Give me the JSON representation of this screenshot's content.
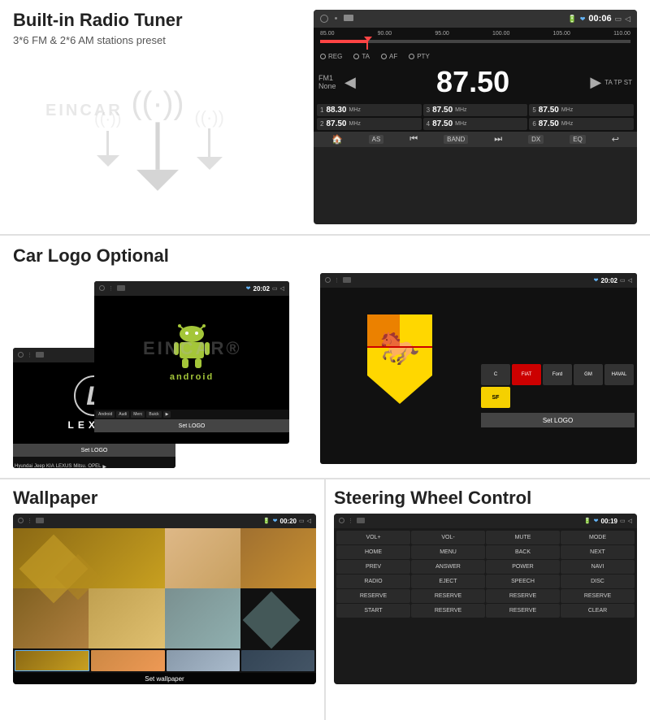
{
  "radio": {
    "title": "Built-in Radio Tuner",
    "subtitle": "3*6 FM & 2*6 AM stations preset",
    "screen": {
      "time": "00:06",
      "freq_label_start": "85.00",
      "freq_label_2": "90.00",
      "freq_label_3": "95.00",
      "freq_label_4": "100.00",
      "freq_label_5": "105.00",
      "freq_label_end": "110.00",
      "options": [
        "REG",
        "TA",
        "AF",
        "PTY"
      ],
      "station": "FM1",
      "station_name": "None",
      "frequency": "87.50",
      "suffix": "TA TP ST",
      "presets": [
        {
          "num": "1",
          "freq": "88.30",
          "unit": "MHz"
        },
        {
          "num": "3",
          "freq": "87.50",
          "unit": "MHz"
        },
        {
          "num": "5",
          "freq": "87.50",
          "unit": "MHz"
        },
        {
          "num": "2",
          "freq": "87.50",
          "unit": "MHz"
        },
        {
          "num": "4",
          "freq": "87.50",
          "unit": "MHz"
        },
        {
          "num": "6",
          "freq": "87.50",
          "unit": "MHz"
        }
      ],
      "controls": [
        "🏠",
        "AS",
        "⏮",
        "BAND",
        "⏭",
        "DX",
        "EQ",
        "↩"
      ]
    }
  },
  "logo": {
    "title": "Car Logo Optional",
    "screens": [
      "Lexus",
      "Android",
      "Ferrari"
    ],
    "set_logo_label": "Set LOGO",
    "brands": [
      "Hyundai",
      "Jeep",
      "KIA",
      "Lexus",
      "Mitsubishi",
      "Opel",
      "Android",
      "Audi",
      "Mercedes",
      "Buick",
      "Citroen",
      "Fiat",
      "Ford",
      "GM",
      "HAVAL"
    ]
  },
  "wallpaper": {
    "title": "Wallpaper",
    "screen_time": "00:20",
    "set_label": "Set wallpaper",
    "colors": [
      "#b8860b",
      "#c8a060",
      "#d4a844",
      "#deb887",
      "#8b6914",
      "#a07840",
      "#c4a030",
      "#b89040"
    ]
  },
  "steering": {
    "title": "Steering Wheel Control",
    "screen_time": "00:19",
    "buttons": [
      "VOL+",
      "VOL-",
      "MUTE",
      "MODE",
      "HOME",
      "MENU",
      "BACK",
      "NEXT",
      "PREV",
      "ANSWER",
      "POWER",
      "NAVI",
      "RADIO",
      "EJECT",
      "SPEECH",
      "DISC",
      "RESERVE",
      "RESERVE",
      "RESERVE",
      "RESERVE",
      "START",
      "RESERVE",
      "RESERVE",
      "CLEAR"
    ]
  }
}
